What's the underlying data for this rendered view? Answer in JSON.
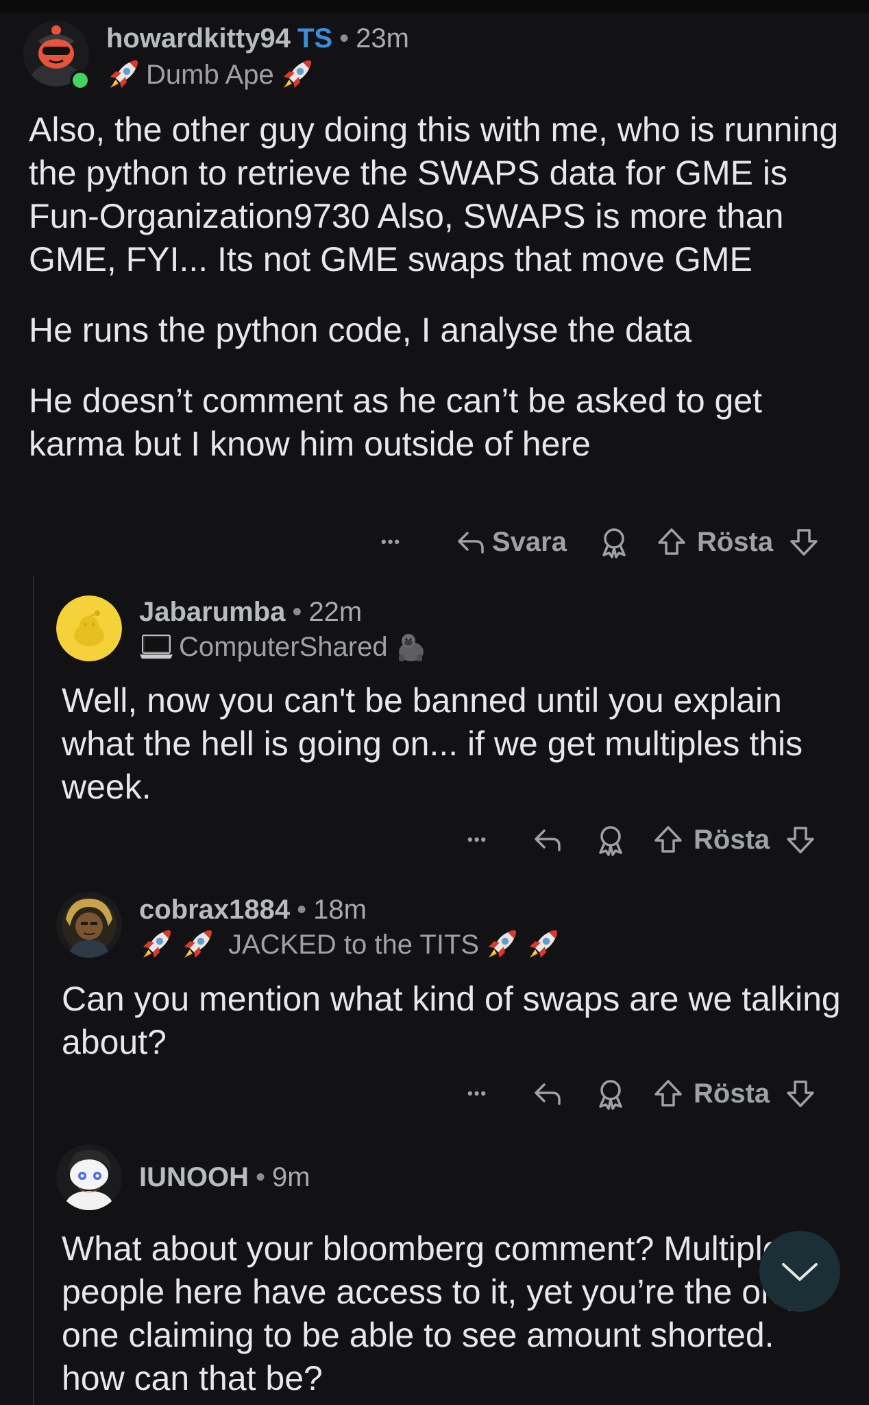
{
  "comments": [
    {
      "username": "howardkitty94",
      "op_tag": "TS",
      "time": "23m",
      "flair": "Dumb Ape",
      "flair_icons": [
        "rocket-icon",
        "rocket-icon"
      ],
      "online": true,
      "paragraphs": [
        "Also, the other guy doing this with me, who is running the python to retrieve the SWAPS data for GME is Fun-Organization9730 Also, SWAPS is more than GME, FYI... Its not GME swaps that move GME",
        "He runs the python code, I analyse the data",
        "He doesn’t comment as he can’t be asked to get karma but I know him outside of here"
      ],
      "actions": {
        "more": "•••",
        "reply": "Svara",
        "vote": "Rösta"
      }
    },
    {
      "username": "Jabarumba",
      "time": "22m",
      "flair": "ComputerShared",
      "flair_icons": [
        "laptop-icon",
        "gorilla-icon"
      ],
      "paragraphs": [
        "Well, now you can't be banned until you explain what the hell is going on... if we get multiples this week."
      ],
      "actions": {
        "more": "•••",
        "vote": "Rösta"
      }
    },
    {
      "username": "cobrax1884",
      "time": "18m",
      "flair": "JACKED to the TITS",
      "flair_icons": [
        "rocket-icon",
        "rocket-icon",
        "rocket-icon",
        "rocket-icon"
      ],
      "paragraphs": [
        "Can you mention what kind of swaps are we talking about?"
      ],
      "actions": {
        "more": "•••",
        "vote": "Rösta"
      }
    },
    {
      "username": "IUNOOH",
      "time": "9m",
      "paragraphs": [
        "What about your bloomberg comment? Multiple people here have access to it, yet you’re the only one claiming to be able to see amount shorted. how can that be?"
      ]
    }
  ],
  "separator": "•",
  "scroll_button_icon": "chevron-down-icon",
  "colors": {
    "background": "#121214",
    "op_tag": "#3e8ed8",
    "online": "#46d160",
    "fab": "#1a2f36"
  }
}
